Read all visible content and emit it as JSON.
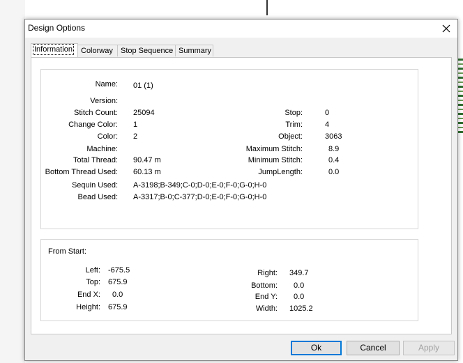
{
  "dialog": {
    "title": "Design Options"
  },
  "tabs": [
    {
      "label": "Information",
      "active": true
    },
    {
      "label": "Colorway"
    },
    {
      "label": "Stop Sequence"
    },
    {
      "label": "Summary"
    }
  ],
  "info": {
    "name": {
      "label": "Name:",
      "value": "01 (1)"
    },
    "version": {
      "label": "Version:",
      "value": ""
    },
    "stitch_count": {
      "label": "Stitch Count:",
      "value": "25094"
    },
    "change_color": {
      "label": "Change Color:",
      "value": "1"
    },
    "color": {
      "label": "Color:",
      "value": "2"
    },
    "machine": {
      "label": "Machine:",
      "value": ""
    },
    "total_thread": {
      "label": "Total Thread:",
      "value": "90.47 m"
    },
    "bottom_thread": {
      "label": "Bottom Thread Used:",
      "value": "60.13 m"
    },
    "sequin_used": {
      "label": "Sequin Used:",
      "value": "A-3198;B-349;C-0;D-0;E-0;F-0;G-0;H-0"
    },
    "bead_used": {
      "label": "Bead Used:",
      "value": "A-3317;B-0;C-377;D-0;E-0;F-0;G-0;H-0"
    },
    "stop": {
      "label": "Stop:",
      "value": "0"
    },
    "trim": {
      "label": "Trim:",
      "value": "4"
    },
    "object": {
      "label": "Object:",
      "value": "3063"
    },
    "max_stitch": {
      "label": "Maximum Stitch:",
      "value": "8.9"
    },
    "min_stitch": {
      "label": "Minimum Stitch:",
      "value": "0.4"
    },
    "jump_length": {
      "label": "JumpLength:",
      "value": "0.0"
    }
  },
  "from_start": {
    "heading": "From Start:",
    "left": {
      "label": "Left:",
      "value": "-675.5"
    },
    "top": {
      "label": "Top:",
      "value": "675.9"
    },
    "end_x": {
      "label": "End X:",
      "value": "0.0"
    },
    "height": {
      "label": "Height:",
      "value": "675.9"
    },
    "right": {
      "label": "Right:",
      "value": "349.7"
    },
    "bottom": {
      "label": "Bottom:",
      "value": "0.0"
    },
    "end_y": {
      "label": "End Y:",
      "value": "0.0"
    },
    "width": {
      "label": "Width:",
      "value": "1025.2"
    }
  },
  "buttons": {
    "ok": "Ok",
    "cancel": "Cancel",
    "apply": "Apply"
  },
  "colors": {
    "dialog_bg": "#f0f0f0",
    "default_button_border": "#0078d7",
    "disabled_text": "#a0a0a0"
  }
}
